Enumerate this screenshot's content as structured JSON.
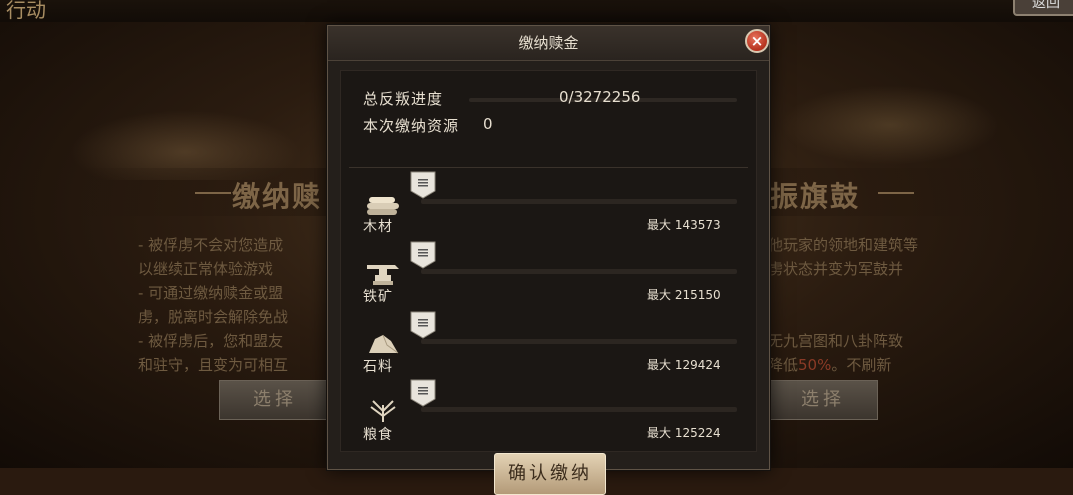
{
  "background": {
    "top_left_text": "行动",
    "top_right_button": "返回",
    "title_left": "缴纳赎",
    "title_right": "振旗鼓",
    "left_lines": [
      "- 被俘虏不会对您造成",
      "以继续正常体验游戏",
      "- 可通过缴纳赎金或盟",
      "虏，脱离时会解除免战",
      "- 被俘虏后，您和盟友",
      "和驻守，且变为可相互"
    ],
    "right_lines": [
      "他玩家的领地和建筑等",
      "虏状态并变为军鼓并",
      "",
      "",
      "无九宫图和八卦阵致",
      "降低",
      "50%",
      "。不刷新"
    ],
    "button_left": "选择",
    "button_right": "选择"
  },
  "dialog": {
    "title": "缴纳赎金",
    "close_label": "×",
    "summary": {
      "progress_label": "总反叛进度",
      "progress_value": "0/3272256",
      "progress_fraction": 0.0,
      "submitted_label": "本次缴纳资源",
      "submitted_value": "0"
    },
    "resources": [
      {
        "name": "木材",
        "max_label": "最大",
        "max_value": "143573",
        "icon": "wood-icon",
        "fraction": 0.0
      },
      {
        "name": "铁矿",
        "max_label": "最大",
        "max_value": "215150",
        "icon": "iron-ore-icon",
        "fraction": 0.0
      },
      {
        "name": "石料",
        "max_label": "最大",
        "max_value": "129424",
        "icon": "stone-icon",
        "fraction": 0.0
      },
      {
        "name": "粮食",
        "max_label": "最大",
        "max_value": "125224",
        "icon": "grain-icon",
        "fraction": 0.0
      }
    ],
    "confirm_label": "确认缴纳"
  },
  "colors": {
    "panel": "#1b1714",
    "text": "#e7dfd0",
    "accent_red": "#b5321e",
    "button_gold": "#e3d2b4"
  }
}
